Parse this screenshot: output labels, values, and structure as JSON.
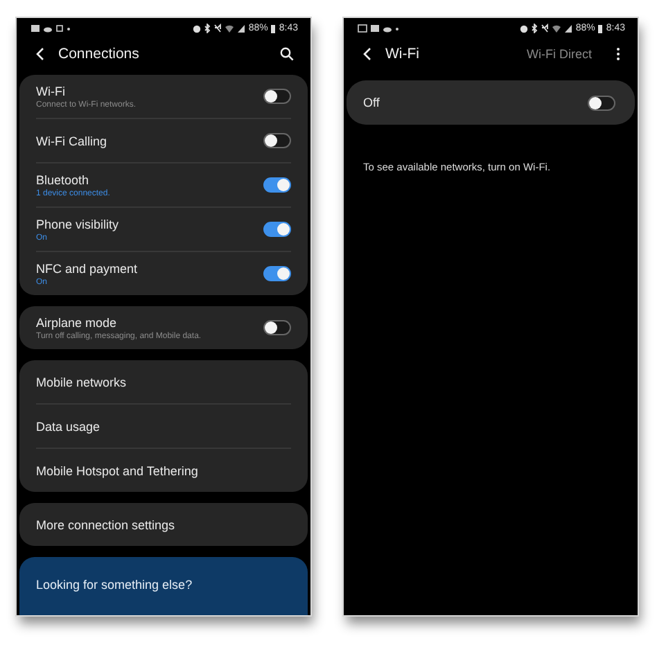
{
  "connections": {
    "status_bar": {
      "battery": "88%",
      "time": "8:43"
    },
    "title": "Connections",
    "groups": [
      {
        "kind": "list",
        "items": [
          {
            "kind": "toggle",
            "label": "Wi-Fi",
            "sub": "Connect to Wi-Fi networks.",
            "sub_highlight": false,
            "on": false
          },
          {
            "kind": "toggle",
            "label": "Wi-Fi Calling",
            "on": false
          },
          {
            "kind": "toggle",
            "label": "Bluetooth",
            "sub": "1 device connected.",
            "sub_highlight": true,
            "on": true
          },
          {
            "kind": "toggle",
            "label": "Phone visibility",
            "sub": "On",
            "sub_highlight": true,
            "on": true
          },
          {
            "kind": "toggle",
            "label": "NFC and payment",
            "sub": "On",
            "sub_highlight": true,
            "on": true
          }
        ]
      },
      {
        "kind": "list",
        "items": [
          {
            "kind": "toggle",
            "label": "Airplane mode",
            "sub": "Turn off calling, messaging, and Mobile data.",
            "sub_highlight": false,
            "on": false
          }
        ]
      },
      {
        "kind": "list",
        "items": [
          {
            "kind": "link",
            "label": "Mobile networks"
          },
          {
            "kind": "link",
            "label": "Data usage"
          },
          {
            "kind": "link",
            "label": "Mobile Hotspot and Tethering"
          }
        ]
      },
      {
        "kind": "list",
        "items": [
          {
            "kind": "link",
            "label": "More connection settings"
          }
        ]
      },
      {
        "kind": "promo",
        "title": "Looking for something else?"
      }
    ]
  },
  "wifi": {
    "status_bar": {
      "battery": "88%",
      "time": "8:43"
    },
    "title": "Wi-Fi",
    "action": "Wi-Fi Direct",
    "master_switch": {
      "label": "Off",
      "on": false
    },
    "message": "To see available networks, turn on Wi-Fi."
  }
}
